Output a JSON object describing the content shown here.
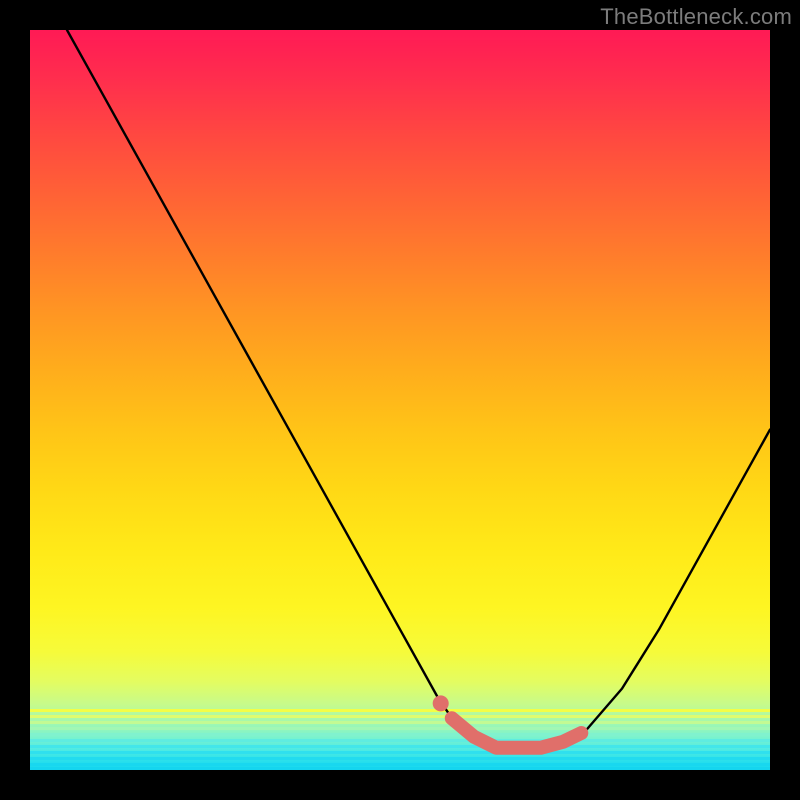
{
  "watermark": "TheBottleneck.com",
  "colors": {
    "stroke_main": "#000000",
    "stroke_highlight": "#e06f6a",
    "background": "#000000"
  },
  "chart_data": {
    "type": "line",
    "title": "",
    "xlabel": "",
    "ylabel": "",
    "xlim": [
      0,
      100
    ],
    "ylim": [
      0,
      100
    ],
    "series": [
      {
        "name": "bottleneck-curve",
        "x": [
          5,
          10,
          15,
          20,
          25,
          30,
          35,
          40,
          45,
          50,
          55,
          57,
          60,
          63,
          66,
          69,
          72,
          75,
          80,
          85,
          90,
          95,
          100
        ],
        "y": [
          100,
          91,
          82,
          73,
          64,
          55,
          46,
          37,
          28,
          19,
          10,
          7,
          4.5,
          3,
          3,
          3,
          3.8,
          5.2,
          11,
          19,
          28,
          37,
          46
        ]
      },
      {
        "name": "highlight-flat-segment",
        "x": [
          57,
          60,
          63,
          66,
          69,
          72,
          74.5
        ],
        "y": [
          7,
          4.5,
          3,
          3,
          3,
          3.8,
          5
        ]
      },
      {
        "name": "highlight-entry-dot",
        "x": [
          55.5
        ],
        "y": [
          9
        ]
      }
    ],
    "notes": "Values are read approximately from pixel positions; the curve descends steeply from upper-left, flattens near y≈3 around x≈63–70, then rises toward upper-right. Highlight marks the near-flat minimum region."
  }
}
